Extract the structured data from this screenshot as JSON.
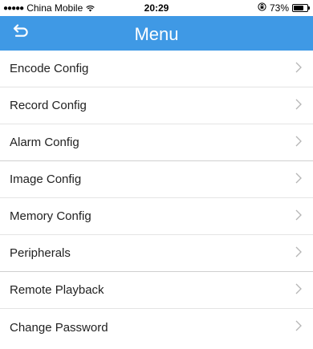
{
  "status_bar": {
    "signal": "●●●●●",
    "carrier": "China Mobile",
    "time": "20:29",
    "battery_percent": "73%",
    "battery_level": 0.73
  },
  "nav": {
    "title": "Menu",
    "back_icon": "back-arrow-icon",
    "background": "#3f99e5"
  },
  "menu": {
    "items": [
      {
        "label": "Encode Config"
      },
      {
        "label": "Record Config"
      },
      {
        "label": "Alarm Config"
      },
      {
        "label": "Image Config"
      },
      {
        "label": "Memory Config"
      },
      {
        "label": "Peripherals"
      },
      {
        "label": "Remote Playback"
      },
      {
        "label": "Change Password"
      }
    ],
    "chevron_icon": "chevron-right-icon"
  }
}
